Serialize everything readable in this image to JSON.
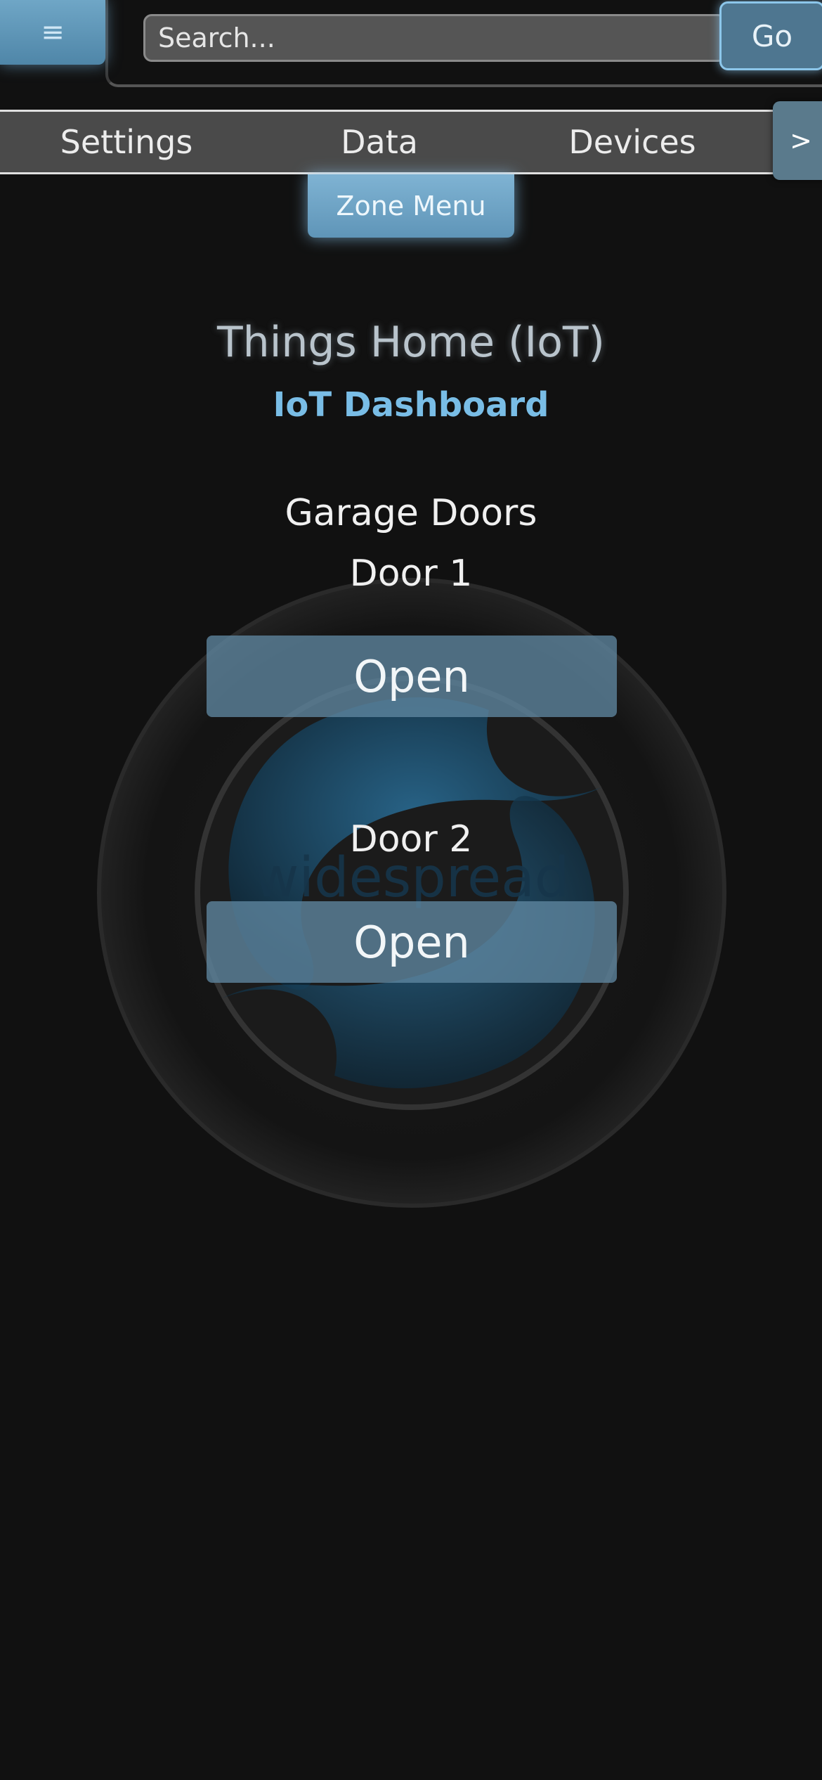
{
  "header": {
    "menu_icon": "≡",
    "search_placeholder": "Search...",
    "go_label": "Go"
  },
  "nav": {
    "items": [
      {
        "label": "Settings"
      },
      {
        "label": "Data"
      },
      {
        "label": "Devices"
      }
    ],
    "next_label": ">"
  },
  "zone_menu_label": "Zone Menu",
  "page_title": "Things Home (IoT)",
  "page_subtitle": "IoT Dashboard",
  "section_title": "Garage Doors",
  "doors": [
    {
      "label": "Door 1",
      "button_label": "Open"
    },
    {
      "label": "Door 2",
      "button_label": "Open"
    }
  ],
  "watermark": {
    "icon": "widespread-logo",
    "text": "widespread"
  },
  "colors": {
    "background": "#111111",
    "accent": "#79bde6",
    "button": "#5f87a0"
  }
}
